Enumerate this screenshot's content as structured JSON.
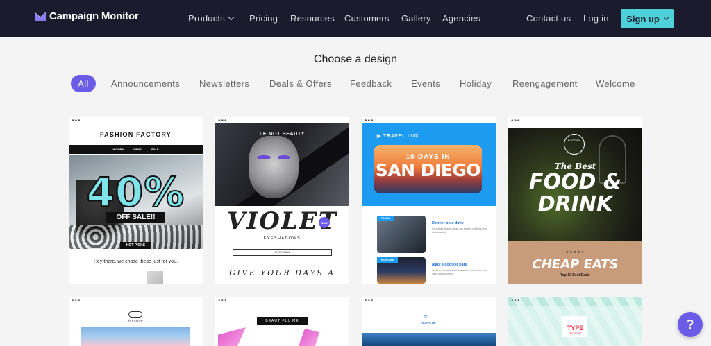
{
  "brand": {
    "name": "Campaign Monitor",
    "logo_icon": "campaign-monitor-logo-icon",
    "accent": "#6b5ce7",
    "nav_bg": "#1c1b2e",
    "signup_bg": "#4fd1d9"
  },
  "nav": {
    "products": "Products",
    "pricing": "Pricing",
    "resources": "Resources",
    "customers": "Customers",
    "gallery": "Gallery",
    "agencies": "Agencies",
    "contact": "Contact us",
    "login": "Log in",
    "signup": "Sign up"
  },
  "page": {
    "title": "Choose a design"
  },
  "filters": [
    "All",
    "Announcements",
    "Newsletters",
    "Deals & Offers",
    "Feedback",
    "Events",
    "Holiday",
    "Reengagement",
    "Welcome"
  ],
  "templates": {
    "fashion": {
      "brand": "FASHION FACTORY",
      "nav": [
        "WOMEN",
        "MENS",
        "SALE"
      ],
      "discount": "40%",
      "offer": "OFF SALE!!",
      "tag": "HOT PICKS",
      "tagline": "Hey there, we chose these just for you."
    },
    "beauty": {
      "brand": "LE MOT BEAUTY",
      "product": "VIOLET",
      "badge": "NEW",
      "subtitle": "EYESHADOWS",
      "cta": "SHOP NOW",
      "footer": "GIVE YOUR DAYS A"
    },
    "travel": {
      "brand": "TRAVEL LUX",
      "headline_top": "10-DAYS IN",
      "headline": "SAN DIEGO",
      "tag1": "TOURS",
      "item1": "Denver on a dime",
      "item1_body": "On budget doesn't mean you have to settle for less than amazing.",
      "tag2": "NIGHTLIFE",
      "item2": "Maui's coolest bars",
      "item2_body": "We'll tell you what's hot and what's not then let you make the discovery."
    },
    "food": {
      "brand": "FOODIES",
      "headline_top": "The Best",
      "headline": "FOOD &",
      "headline2": "DRINK",
      "rating": "★★★★☆",
      "footer": "CHEAP EATS",
      "footer_sub": "Top 10 Best Deals"
    },
    "row2a": {
      "brand": "HIPSHOP"
    },
    "row2b": {
      "brand": "BEAUTIFUL ME"
    },
    "row2c": {
      "brand": "SURFS UP"
    },
    "row2d": {
      "brand": "TYPE",
      "brand_sub": "MAGAZINE"
    }
  },
  "help": {
    "label": "?"
  }
}
